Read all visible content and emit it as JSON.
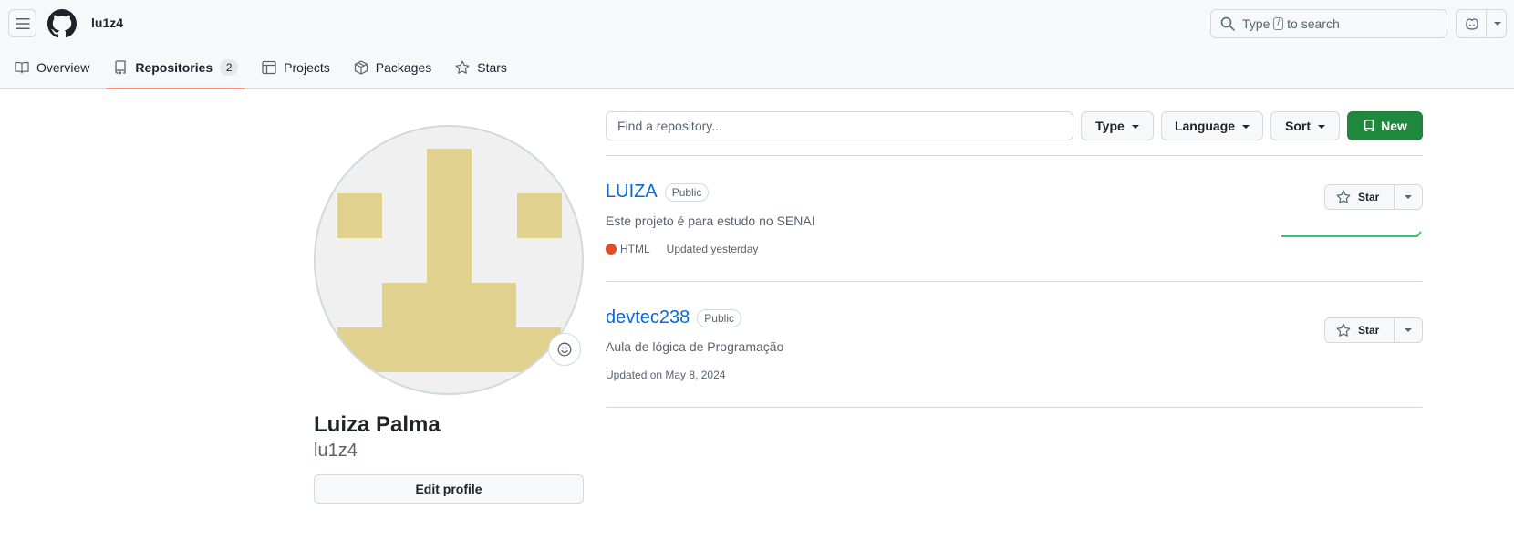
{
  "header": {
    "username": "lu1z4",
    "search": {
      "prefix": "Type",
      "key": "/",
      "suffix": "to search"
    }
  },
  "tabs": [
    {
      "label": "Overview",
      "icon": "book-icon"
    },
    {
      "label": "Repositories",
      "icon": "repo-icon",
      "count": "2",
      "selected": true
    },
    {
      "label": "Projects",
      "icon": "table-icon"
    },
    {
      "label": "Packages",
      "icon": "package-icon"
    },
    {
      "label": "Stars",
      "icon": "star-icon"
    }
  ],
  "profile": {
    "full_name": "Luiza Palma",
    "login": "lu1z4",
    "edit_label": "Edit profile",
    "avatar_color": "#e0d28e"
  },
  "filters": {
    "search_placeholder": "Find a repository...",
    "type_label": "Type",
    "language_label": "Language",
    "sort_label": "Sort",
    "new_label": "New"
  },
  "repos": [
    {
      "name": "LUIZA",
      "visibility": "Public",
      "description": "Este projeto é para estudo no SENAI",
      "language": "HTML",
      "language_color": "#e34c26",
      "updated": "Updated yesterday",
      "star_label": "Star"
    },
    {
      "name": "devtec238",
      "visibility": "Public",
      "description": "Aula de lógica de Programação",
      "updated": "Updated on May 8, 2024",
      "star_label": "Star"
    }
  ],
  "colors": {
    "accent_tab": "#fd8c73",
    "link": "#0969da",
    "primary_button": "#1f883d"
  }
}
